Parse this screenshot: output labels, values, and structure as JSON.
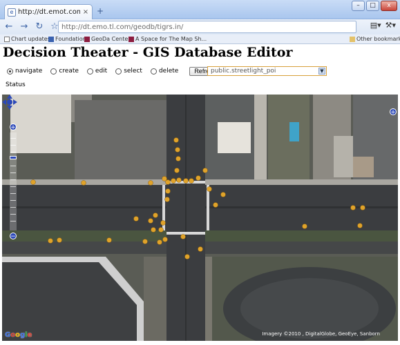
{
  "browser": {
    "tab_title": "http://dt.emot.com/geodb...",
    "tab_close": "×",
    "new_tab": "+",
    "url": "http://dt.emo.tl.com/geodb/tigrs.in/",
    "back": "←",
    "forward": "→",
    "reload": "↻",
    "star": "☆",
    "window_min": "–",
    "window_max": "□",
    "window_close": "x",
    "page_menu": "▤▾",
    "wrench_menu": "⚒▾",
    "bookmarks": [
      {
        "label": "Chart updates",
        "icon": "page-icon"
      },
      {
        "label": "Foundation",
        "icon": "folder-icon"
      },
      {
        "label": "GeoDa Center",
        "icon": "asu-icon"
      },
      {
        "label": "A Space for The Map Sh...",
        "icon": "asu-icon"
      }
    ],
    "other_bookmarks": "Other bookmarks"
  },
  "page": {
    "title": "Decision Theater - GIS Database Editor",
    "modes": [
      {
        "label": "navigate",
        "selected": true
      },
      {
        "label": "create",
        "selected": false
      },
      {
        "label": "edit",
        "selected": false
      },
      {
        "label": "select",
        "selected": false
      },
      {
        "label": "delete",
        "selected": false
      }
    ],
    "refresh_label": "Refresh",
    "dataset_value": "public.streetlight_poi",
    "status_label": "Status"
  },
  "map": {
    "google_logo": [
      "G",
      "o",
      "o",
      "g",
      "l",
      "e"
    ],
    "copyright": "Imagery ©2010 , DigitalGlobe, GeoEye, Sanborn"
  },
  "colors": {
    "marker": "#e0a32a",
    "map_control": "#2b48b8",
    "road": "#3b3d40",
    "pavement": "#cfcfcf"
  }
}
